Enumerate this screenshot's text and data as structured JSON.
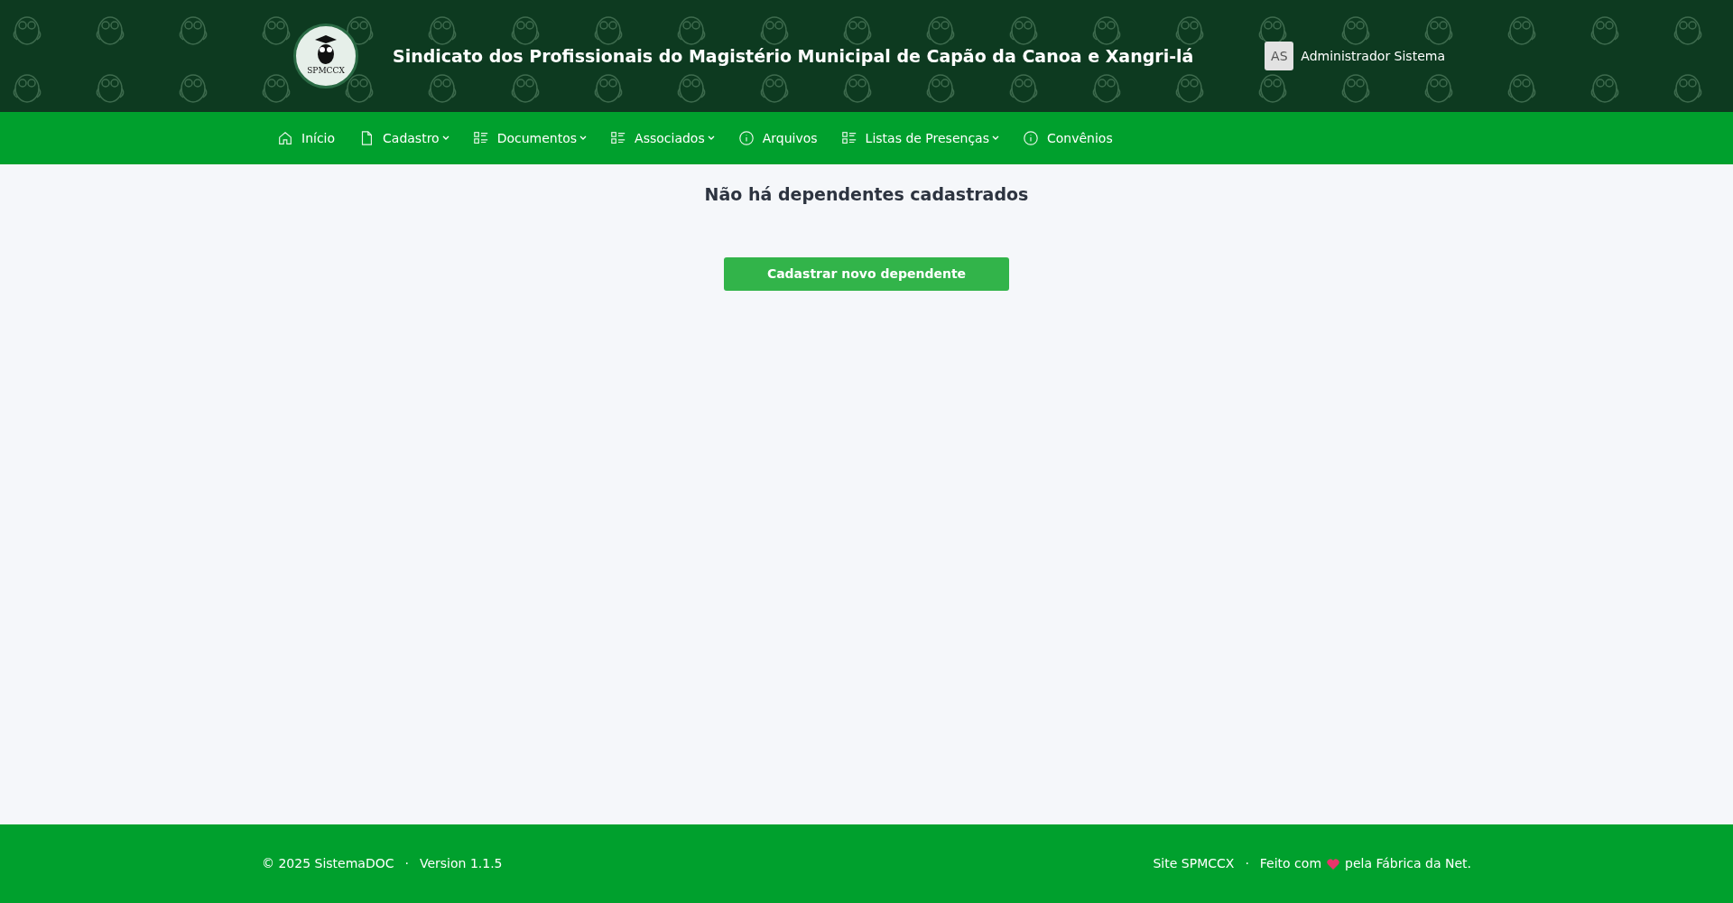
{
  "header": {
    "logo_text": "SPMCCX",
    "title": "Sindicato dos Profissionais do Magistério Municipal de Capão da Canoa e Xangri-lá",
    "user": {
      "initials": "AS",
      "name": "Administrador Sistema"
    }
  },
  "nav": [
    {
      "label": "Início",
      "kind": "home",
      "dropdown": false
    },
    {
      "label": "Cadastro",
      "kind": "file",
      "dropdown": true
    },
    {
      "label": "Documentos",
      "kind": "list",
      "dropdown": true
    },
    {
      "label": "Associados",
      "kind": "list",
      "dropdown": true
    },
    {
      "label": "Arquivos",
      "kind": "info",
      "dropdown": false
    },
    {
      "label": "Listas de Presenças",
      "kind": "list",
      "dropdown": true
    },
    {
      "label": "Convênios",
      "kind": "info",
      "dropdown": false
    }
  ],
  "main": {
    "heading": "Não há dependentes cadastrados",
    "button": "Cadastrar novo dependente"
  },
  "footer": {
    "left": [
      "© 2025 SistemaDOC",
      "Version 1.1.5"
    ],
    "separator_left": "·",
    "separator_right": "·",
    "site_link": "Site SPMCCX",
    "made_with_before": "Feito com",
    "made_with_after": "pela Fábrica da Net."
  }
}
